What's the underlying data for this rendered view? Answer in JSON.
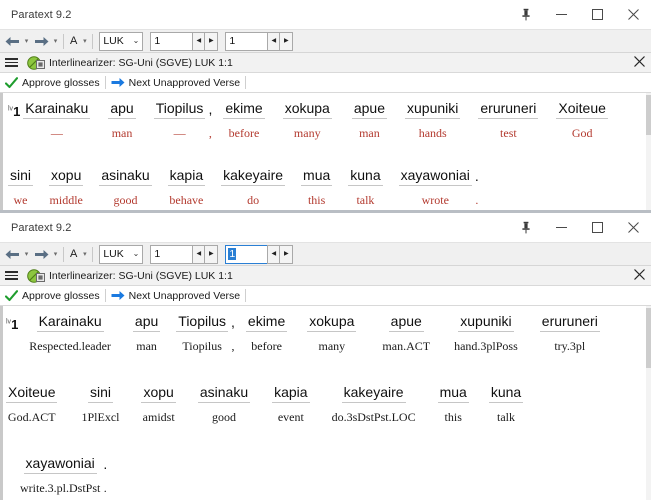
{
  "app": {
    "title": "Paratext 9.2"
  },
  "caption": {
    "pin": "pin-icon",
    "minimize": "minimize-icon",
    "maximize": "maximize-icon",
    "close": "close-icon"
  },
  "toolbar": {
    "back": "back-arrow-icon",
    "back_caret": "▾",
    "forward": "forward-arrow-icon",
    "forward_caret": "▾",
    "font_label": "A",
    "font_caret": "▾",
    "book": "LUK",
    "book_caret": "⌄",
    "chapter": "1",
    "verse": "1",
    "spin_prev": "◀",
    "spin_next": "▶"
  },
  "panel": {
    "title": "Interlinearizer: SG-Uni (SGVE) LUK 1:1",
    "close": "✕",
    "menu": "hamburger-icon",
    "project_icon": "interlinear-project-icon"
  },
  "actions": {
    "approve": "Approve glosses",
    "approve_icon": "check-icon",
    "next_unapproved": "Next Unapproved Verse",
    "next_icon": "blue-arrow-icon"
  },
  "window1": {
    "verse_number": "1",
    "verse_marker": "lv",
    "gloss_color": "#b33a2f",
    "lines": [
      {
        "words": [
          {
            "surface": "Karainaku",
            "gloss": "—"
          },
          {
            "surface": "apu",
            "gloss": "man"
          },
          {
            "surface": "Tiopilus",
            "gloss": "—"
          },
          {
            "punct": ",",
            "gloss": ","
          },
          {
            "surface": "ekime",
            "gloss": "before"
          },
          {
            "surface": "xokupa",
            "gloss": "many"
          },
          {
            "surface": "apue",
            "gloss": "man"
          },
          {
            "surface": "xupuniki",
            "gloss": "hands"
          },
          {
            "surface": "eruruneri",
            "gloss": "test"
          },
          {
            "surface": "Xoiteue",
            "gloss": "God"
          }
        ]
      },
      {
        "words": [
          {
            "surface": "sini",
            "gloss": "we"
          },
          {
            "surface": "xopu",
            "gloss": "middle"
          },
          {
            "surface": "asinaku",
            "gloss": "good"
          },
          {
            "surface": "kapia",
            "gloss": "behave"
          },
          {
            "surface": "kakeyaire",
            "gloss": "do"
          },
          {
            "surface": "mua",
            "gloss": "this"
          },
          {
            "surface": "kuna",
            "gloss": "talk"
          },
          {
            "surface": "xayawoniai",
            "gloss": "wrote"
          },
          {
            "punct": ".",
            "gloss": "."
          }
        ]
      }
    ]
  },
  "window2": {
    "verse_number": "1",
    "verse_marker": "lv",
    "gloss_color": "#1a1a1a",
    "verse_field_selected": true,
    "lines": [
      {
        "words": [
          {
            "surface": "Karainaku",
            "gloss": "Respected.leader"
          },
          {
            "surface": "apu",
            "gloss": "man"
          },
          {
            "surface": "Tiopilus",
            "gloss": "Tiopilus"
          },
          {
            "punct": ",",
            "gloss": ","
          },
          {
            "surface": "ekime",
            "gloss": "before"
          },
          {
            "surface": "xokupa",
            "gloss": "many"
          },
          {
            "surface": "apue",
            "gloss": "man.ACT"
          },
          {
            "surface": "xupuniki",
            "gloss": "hand.3plPoss"
          },
          {
            "surface": "eruruneri",
            "gloss": "try.3pl"
          }
        ]
      },
      {
        "words": [
          {
            "surface": "Xoiteue",
            "gloss": "God.ACT"
          },
          {
            "surface": "sini",
            "gloss": "1PlExcl"
          },
          {
            "surface": "xopu",
            "gloss": "amidst"
          },
          {
            "surface": "asinaku",
            "gloss": "good"
          },
          {
            "surface": "kapia",
            "gloss": "event"
          },
          {
            "surface": "kakeyaire",
            "gloss": "do.3sDstPst.LOC"
          },
          {
            "surface": "mua",
            "gloss": "this"
          },
          {
            "surface": "kuna",
            "gloss": "talk"
          }
        ]
      },
      {
        "words": [
          {
            "surface": "xayawoniai",
            "gloss": "write.3.pl.DstPst"
          },
          {
            "punct": ".",
            "gloss": "."
          }
        ]
      }
    ]
  }
}
